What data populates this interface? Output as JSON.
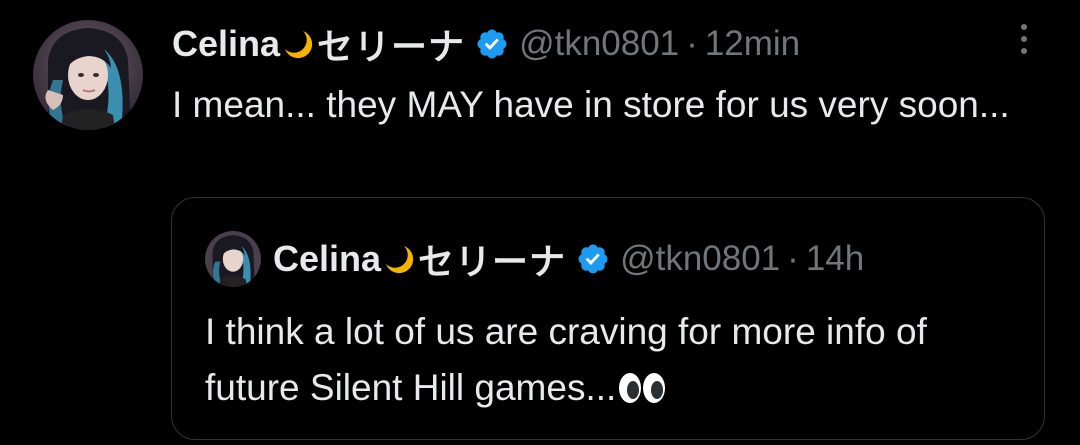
{
  "tweet": {
    "author_name": "Celina",
    "author_name_kana": "セリーナ",
    "handle": "@tkn0801",
    "separator": "·",
    "time": "12min",
    "text": "I mean... they MAY have in store for us very soon...",
    "verified": true
  },
  "quoted_tweet": {
    "author_name": "Celina",
    "author_name_kana": "セリーナ",
    "handle": "@tkn0801",
    "separator": "·",
    "time": "14h",
    "text": "I think a lot of us are craving for more info of future Silent Hill games...",
    "verified": true
  },
  "colors": {
    "background": "#000000",
    "text_primary": "#e7e9ea",
    "text_secondary": "#71767b",
    "verified_blue": "#1d9bf0",
    "border": "#2f3336",
    "moon": "#f4b400"
  },
  "icons": {
    "moon": "crescent-moon-emoji",
    "verified": "verified-badge-icon",
    "more": "more-options-icon",
    "eyes": "eyes-emoji"
  }
}
